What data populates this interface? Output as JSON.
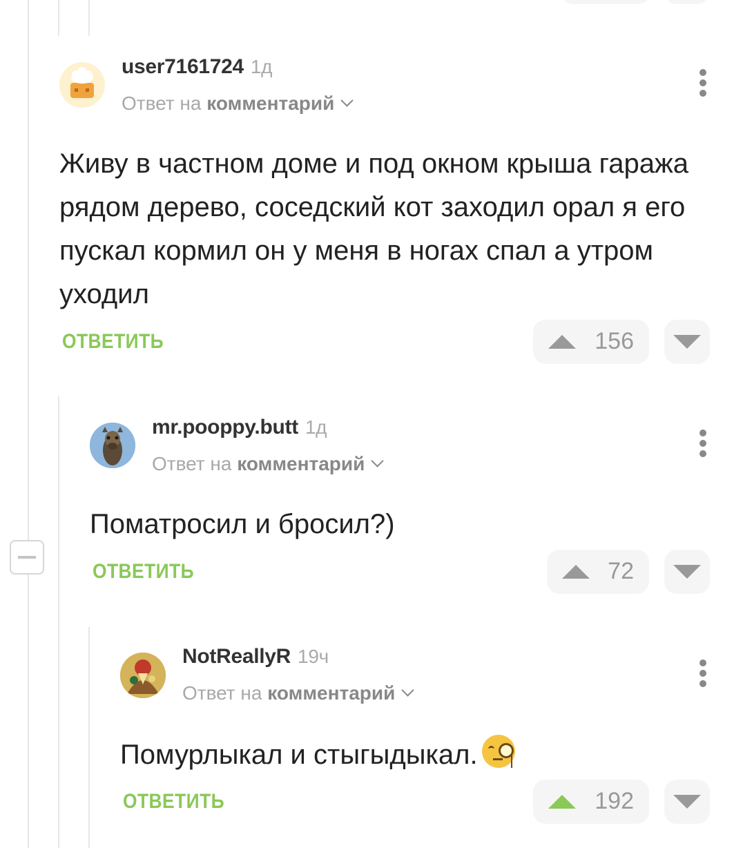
{
  "reply_prefix": "Ответ на",
  "reply_target": "комментарий",
  "reply_button_label": "ОТВЕТИТЬ",
  "accent_color": "#8ac858",
  "comments": [
    {
      "username": "user7161724",
      "time": "1д",
      "text": "Живу в частном доме и под окном крыша гаража  рядом дерево, соседский кот заходил орал я его пускал кормил он у меня в ногах спал а утром уходил",
      "rating": "156",
      "upvoted": false
    },
    {
      "username": "mr.pooppy.butt",
      "time": "1д",
      "text": "Поматросил и бросил?)",
      "rating": "72",
      "upvoted": false
    },
    {
      "username": "NotReallyR",
      "time": "19ч",
      "text": "Помурлыкал и стыгыдыкал.",
      "emoji": "monocle-face-emoji",
      "rating": "192",
      "upvoted": true
    }
  ]
}
